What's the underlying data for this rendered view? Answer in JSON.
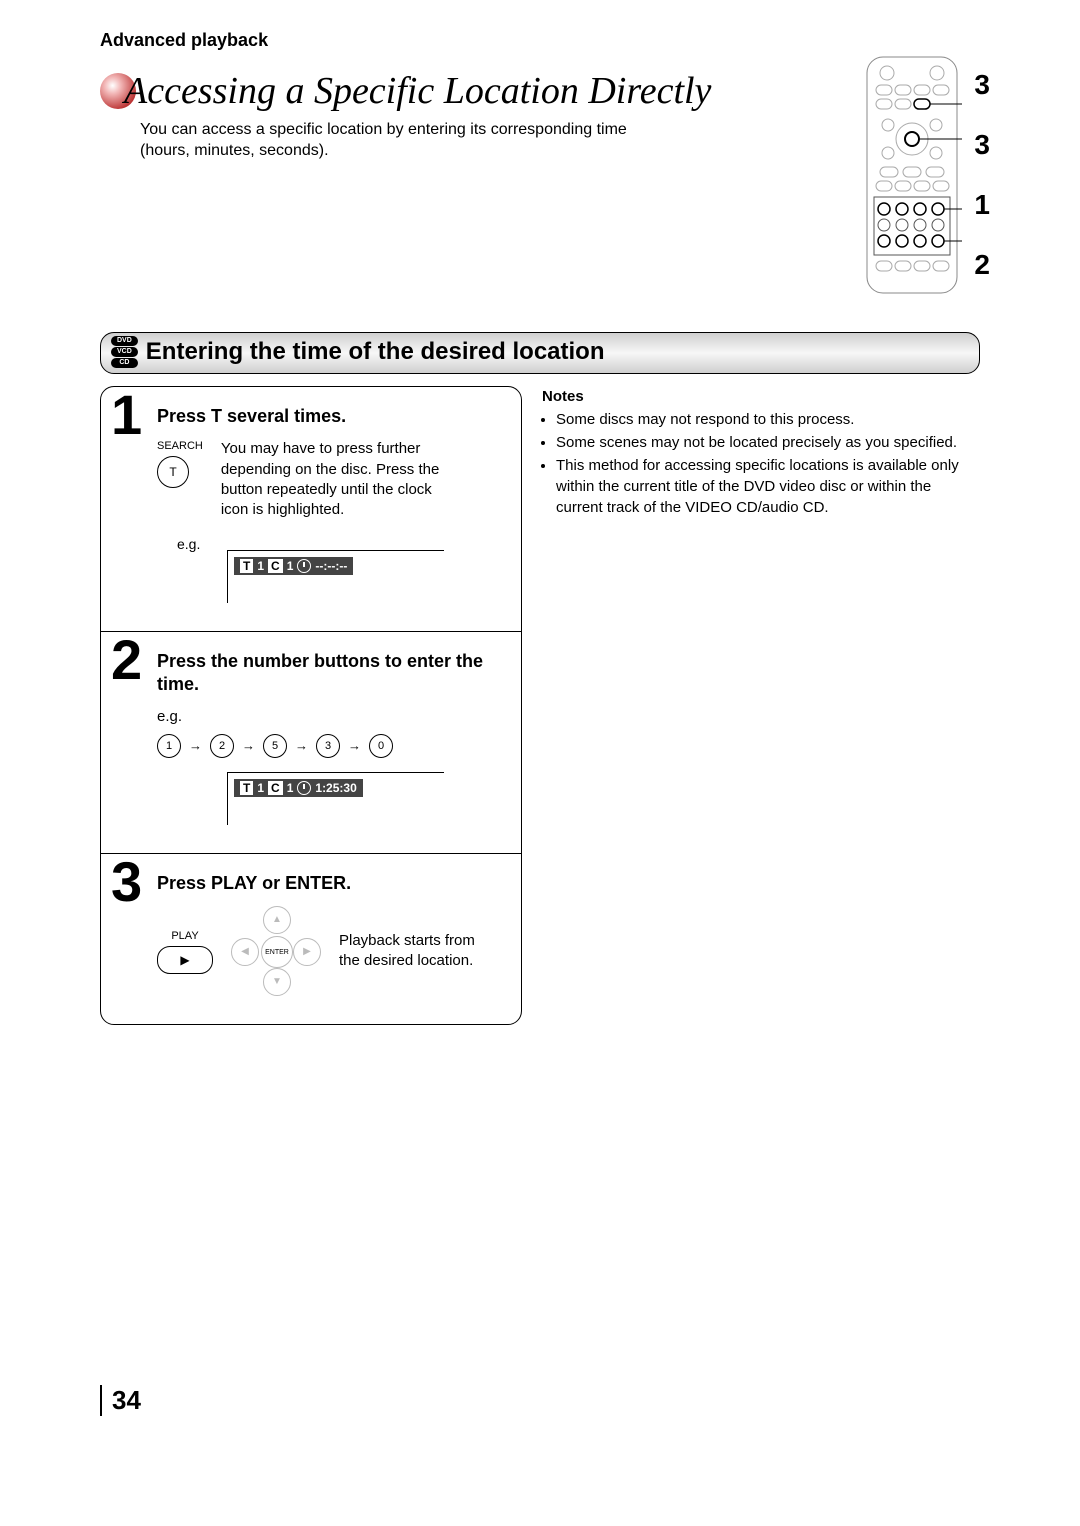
{
  "section_head": "Advanced playback",
  "title": "Accessing a Specific Location Directly",
  "intro": "You can access a specific location by entering its corresponding time (hours, minutes, seconds).",
  "remote_callouts": [
    "3",
    "3",
    "1",
    "2"
  ],
  "disc_badges": [
    "DVD",
    "VCD",
    "CD"
  ],
  "section_bar_title": "Entering the time of the desired location",
  "steps": {
    "s1": {
      "num": "1",
      "title": "Press T several times.",
      "search_label": "SEARCH",
      "search_btn": "T",
      "body": "You may have to press further depending on the disc. Press the button repeatedly until the clock icon is highlighted.",
      "eg": "e.g.",
      "osd_T": "T",
      "osd_T_val": "1",
      "osd_C": "C",
      "osd_C_val": "1",
      "osd_time": "--:--:--"
    },
    "s2": {
      "num": "2",
      "title": "Press the number buttons to enter the time.",
      "eg": "e.g.",
      "numbers": [
        "1",
        "2",
        "5",
        "3",
        "0"
      ],
      "osd_T": "T",
      "osd_T_val": "1",
      "osd_C": "C",
      "osd_C_val": "1",
      "osd_time": "1:25:30"
    },
    "s3": {
      "num": "3",
      "title": "Press PLAY or ENTER.",
      "play_label": "PLAY",
      "play_glyph": "▶",
      "enter_label": "ENTER",
      "body": "Playback starts from the desired location."
    }
  },
  "notes": {
    "title": "Notes",
    "items": [
      "Some discs may not respond to this process.",
      "Some scenes may not be located precisely as you specified.",
      "This method for accessing specific locations is available only within the current title of the DVD video disc or within the current track of the VIDEO CD/audio CD."
    ]
  },
  "page_number": "34"
}
